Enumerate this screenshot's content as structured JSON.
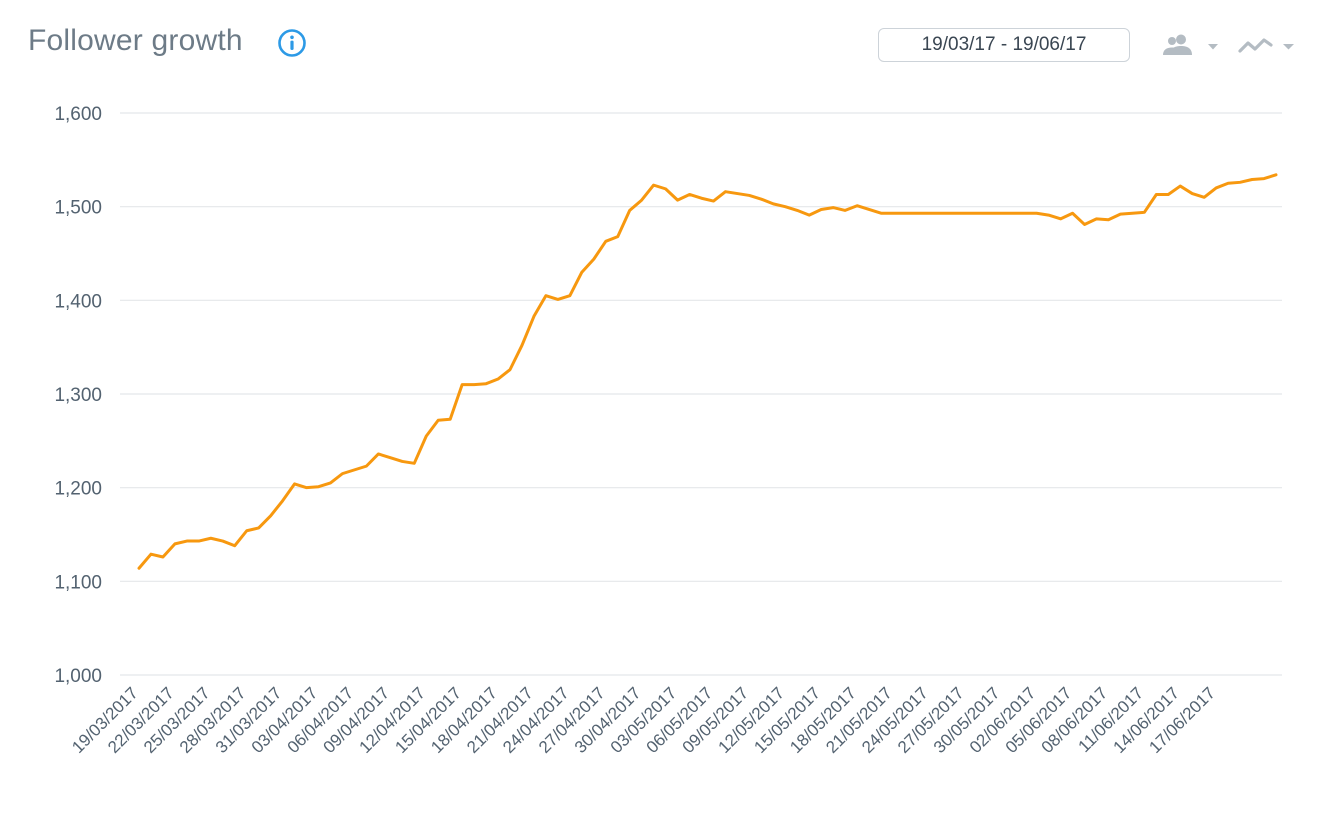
{
  "header": {
    "title": "Follower growth",
    "date_range": "19/03/17 - 19/06/17",
    "icons": {
      "info": "info-icon",
      "audience": "people-icon",
      "chart_type": "line-chart-icon",
      "dropdown": "caret-down-icon"
    }
  },
  "colors": {
    "line": "#f7980f",
    "info_blue": "#2d9ae6",
    "grid": "#e4e7ea",
    "axis_text": "#536270",
    "icon_gray": "#b4bcc3"
  },
  "chart_data": {
    "type": "line",
    "title": "",
    "xlabel": "",
    "ylabel": "",
    "ylim": [
      1000,
      1600
    ],
    "yticks": [
      "1,000",
      "1,100",
      "1,200",
      "1,300",
      "1,400",
      "1,500",
      "1,600"
    ],
    "ytick_values": [
      1000,
      1100,
      1200,
      1300,
      1400,
      1500,
      1600
    ],
    "grid": true,
    "legend": "none",
    "x_start": "19/03/2017",
    "x_end": "19/06/2017",
    "x_tick_labels": [
      "19/03/2017",
      "22/03/2017",
      "25/03/2017",
      "28/03/2017",
      "31/03/2017",
      "03/04/2017",
      "06/04/2017",
      "09/04/2017",
      "12/04/2017",
      "15/04/2017",
      "18/04/2017",
      "21/04/2017",
      "24/04/2017",
      "27/04/2017",
      "30/04/2017",
      "03/05/2017",
      "06/05/2017",
      "09/05/2017",
      "12/05/2017",
      "15/05/2017",
      "18/05/2017",
      "21/05/2017",
      "24/05/2017",
      "27/05/2017",
      "30/05/2017",
      "02/06/2017",
      "05/06/2017",
      "08/06/2017",
      "11/06/2017",
      "14/06/2017",
      "17/06/2017"
    ],
    "series": [
      {
        "values": [
          1114,
          1129,
          1126,
          1140,
          1143,
          1143,
          1146,
          1143,
          1138,
          1154,
          1157,
          1170,
          1186,
          1204,
          1200,
          1201,
          1205,
          1215,
          1219,
          1223,
          1236,
          1232,
          1228,
          1226,
          1255,
          1272,
          1273,
          1310,
          1310,
          1311,
          1316,
          1326,
          1352,
          1383,
          1405,
          1401,
          1405,
          1430,
          1444,
          1463,
          1468,
          1496,
          1507,
          1523,
          1519,
          1507,
          1513,
          1509,
          1506,
          1516,
          1514,
          1512,
          1508,
          1503,
          1500,
          1496,
          1491,
          1497,
          1499,
          1496,
          1501,
          1497,
          1493,
          1493,
          1493,
          1493,
          1493,
          1493,
          1493,
          1493,
          1493,
          1493,
          1493,
          1493,
          1493,
          1493,
          1491,
          1487,
          1493,
          1481,
          1487,
          1486,
          1492,
          1493,
          1494,
          1513,
          1513,
          1522,
          1514,
          1510,
          1520,
          1525,
          1526,
          1529,
          1530,
          1534
        ]
      }
    ]
  }
}
